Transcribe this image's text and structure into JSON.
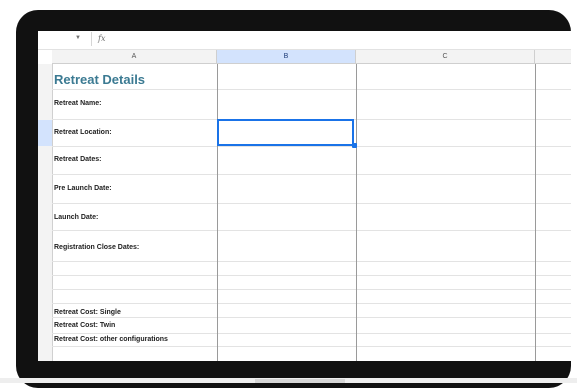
{
  "formula_bar": {
    "dropdown_glyph": "▼",
    "fx_label": "fx"
  },
  "columns": [
    "A",
    "B",
    "C"
  ],
  "sheet": {
    "title": "Retreat Details",
    "labels": [
      "Retreat Name:",
      "Retreat Location:",
      "Retreat Dates:",
      "Pre Launch Date:",
      "Launch Date:",
      "Registration Close Dates:",
      "Retreat Cost:  Single",
      "Retreat Cost:  Twin",
      "Retreat Cost: other configurations"
    ]
  },
  "selection": {
    "active_column": "B",
    "active_label": "Retreat Location:"
  },
  "colors": {
    "title": "#3b7a92",
    "selection": "#1a73e8",
    "header_selected": "#d3e3fd"
  }
}
